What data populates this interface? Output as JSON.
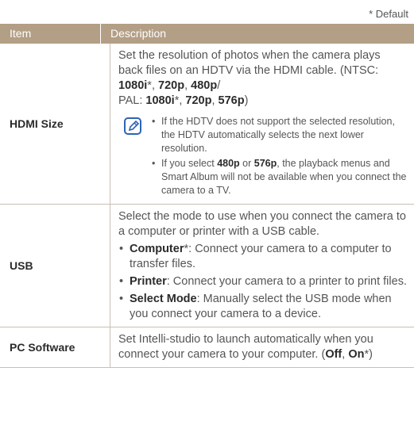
{
  "default_note": "* Default",
  "header": {
    "item": "Item",
    "description": "Description"
  },
  "hdmi": {
    "item": "HDMI Size",
    "desc_intro": "Set the resolution of photos when the camera plays back files on an HDTV via the HDMI cable. (NTSC: ",
    "ntsc_1080i": "1080i",
    "star": "*",
    "ntsc_720p": "720p",
    "ntsc_480p": "480p",
    "pal_prefix": " PAL: ",
    "pal_1080i": "1080i",
    "pal_720p": "720p",
    "pal_576p": "576p",
    "note1": "If the HDTV does not support the selected resolution, the HDTV automatically selects the next lower resolution.",
    "note2_a": "If you select ",
    "note2_b_480p": "480p",
    "note2_or": " or ",
    "note2_576p": "576p",
    "note2_c": ", the playback menus and Smart Album will not be available when you connect the camera to a TV."
  },
  "usb": {
    "item": "USB",
    "intro": "Select the mode to use when you connect the camera to a computer or printer with a USB cable.",
    "b1_label": "Computer",
    "b1_text": ": Connect your camera to a computer to transfer files.",
    "b2_label": "Printer",
    "b2_text": ": Connect your camera to a printer to print files.",
    "b3_label": "Select Mode",
    "b3_text": ": Manually select the USB mode when you connect your camera to a device."
  },
  "pc": {
    "item": "PC Software",
    "text": "Set Intelli-studio to launch automatically when you connect your camera to your computer. (",
    "off": "Off",
    "on": "On",
    "end": ")"
  }
}
